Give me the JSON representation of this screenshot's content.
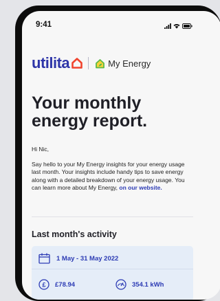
{
  "status_bar": {
    "time": "9:41",
    "icons": [
      "signal-icon",
      "wifi-icon",
      "battery-icon"
    ]
  },
  "brand": {
    "logo_text": "utilita",
    "product_name": "My Energy",
    "colors": {
      "brand_blue": "#2e35a8",
      "house_orange": "#f0442e",
      "leaf_green": "#5ab94a",
      "link_blue": "#2c3bb4",
      "card_blue": "#e5edf8"
    }
  },
  "report": {
    "headline": "Your monthly energy report.",
    "greeting": "Hi Nic,",
    "intro": "Say hello to your My Energy insights for your energy usage last month. Your insights include handy tips to save energy along with a detailed breakdown of your energy usage. You can learn more about My Energy,",
    "intro_link": "on our website."
  },
  "activity": {
    "title": "Last month's activity",
    "date_range": "1 May - 31 May 2022",
    "cost": "£78.94",
    "usage": "354.1 kWh",
    "icons": [
      "calendar-icon",
      "pound-icon",
      "gauge-icon"
    ]
  }
}
